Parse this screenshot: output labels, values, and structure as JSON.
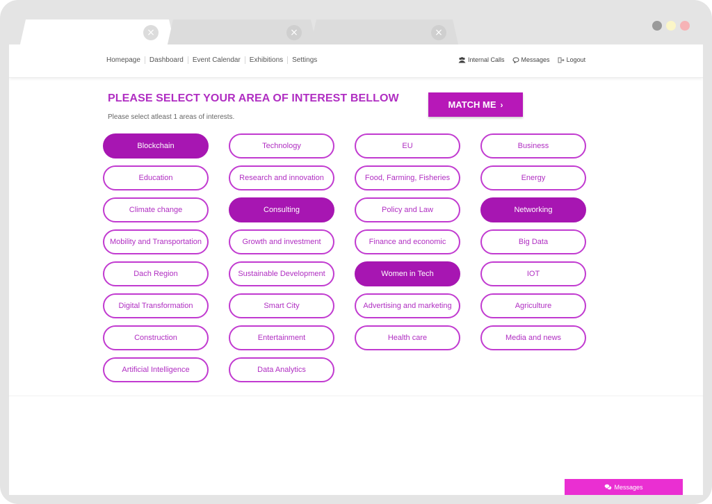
{
  "browser": {
    "tabs": [
      {
        "close_icon": "×"
      },
      {
        "close_icon": "×"
      },
      {
        "close_icon": "×"
      }
    ]
  },
  "nav": {
    "links": [
      "Homepage",
      "Dashboard",
      "Event Calendar",
      "Exhibitions",
      "Settings"
    ],
    "right": {
      "internal_calls": "Internal Calls",
      "messages": "Messages",
      "logout": "Logout"
    }
  },
  "main": {
    "heading": "PLEASE SELECT YOUR AREA OF INTEREST BELLOW",
    "subheading": "Please select atleast 1 areas of interests.",
    "match_button": "MATCH ME",
    "match_chevron": "›",
    "interests": [
      {
        "label": "Blockchain",
        "selected": true
      },
      {
        "label": "Technology",
        "selected": false
      },
      {
        "label": "EU",
        "selected": false
      },
      {
        "label": "Business",
        "selected": false
      },
      {
        "label": "Education",
        "selected": false
      },
      {
        "label": "Research and innovation",
        "selected": false
      },
      {
        "label": "Food, Farming, Fisheries",
        "selected": false
      },
      {
        "label": "Energy",
        "selected": false
      },
      {
        "label": "Climate change",
        "selected": false
      },
      {
        "label": "Consulting",
        "selected": true
      },
      {
        "label": "Policy and Law",
        "selected": false
      },
      {
        "label": "Networking",
        "selected": true
      },
      {
        "label": "Mobility and Transportation",
        "selected": false
      },
      {
        "label": "Growth and investment",
        "selected": false
      },
      {
        "label": "Finance and economic",
        "selected": false
      },
      {
        "label": "Big Data",
        "selected": false
      },
      {
        "label": "Dach Region",
        "selected": false
      },
      {
        "label": "Sustainable Development",
        "selected": false
      },
      {
        "label": "Women in Tech",
        "selected": true
      },
      {
        "label": "IOT",
        "selected": false
      },
      {
        "label": "Digital Transformation",
        "selected": false
      },
      {
        "label": "Smart City",
        "selected": false
      },
      {
        "label": "Advertising and marketing",
        "selected": false
      },
      {
        "label": "Agriculture",
        "selected": false
      },
      {
        "label": "Construction",
        "selected": false
      },
      {
        "label": "Entertainment",
        "selected": false
      },
      {
        "label": "Health care",
        "selected": false
      },
      {
        "label": "Media and news",
        "selected": false
      },
      {
        "label": "Artificial Intelligence",
        "selected": false
      },
      {
        "label": "Data Analytics",
        "selected": false
      }
    ]
  },
  "messages_bar": {
    "label": "Messages"
  },
  "colors": {
    "accent": "#b718b8",
    "selected_fill": "#a716b2",
    "outline": "#c13ad0",
    "text_accent": "#b02ec2",
    "messages_bar": "#ea2fd2"
  },
  "icons": {
    "tab_close": "close-icon",
    "internal_calls": "users-icon",
    "messages": "chat-bubble-icon",
    "logout": "logout-icon",
    "messages_bar": "chat-bubbles-icon"
  }
}
